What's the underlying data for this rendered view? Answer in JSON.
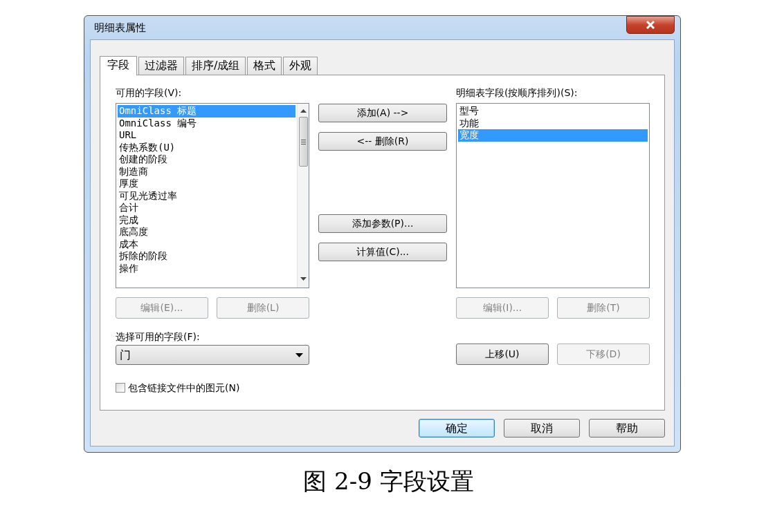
{
  "window": {
    "title": "明细表属性"
  },
  "tabs": [
    {
      "label": "字段",
      "selected": true
    },
    {
      "label": "过滤器",
      "selected": false
    },
    {
      "label": "排序/成组",
      "selected": false
    },
    {
      "label": "格式",
      "selected": false
    },
    {
      "label": "外观",
      "selected": false
    }
  ],
  "available_fields": {
    "label": "可用的字段(V):",
    "items": [
      {
        "text": "OmniClass 标题",
        "selected": true
      },
      {
        "text": "OmniClass 编号",
        "selected": false
      },
      {
        "text": "URL",
        "selected": false
      },
      {
        "text": "传热系数(U)",
        "selected": false
      },
      {
        "text": "创建的阶段",
        "selected": false
      },
      {
        "text": "制造商",
        "selected": false
      },
      {
        "text": "厚度",
        "selected": false
      },
      {
        "text": "可见光透过率",
        "selected": false
      },
      {
        "text": "合计",
        "selected": false
      },
      {
        "text": "完成",
        "selected": false
      },
      {
        "text": "底高度",
        "selected": false
      },
      {
        "text": "成本",
        "selected": false
      },
      {
        "text": "拆除的阶段",
        "selected": false
      },
      {
        "text": "操作",
        "selected": false
      }
    ],
    "buttons": [
      {
        "label": "编辑(E)...",
        "disabled": true
      },
      {
        "label": "删除(L)",
        "disabled": true
      }
    ]
  },
  "middle_buttons": [
    {
      "label": "添加(A) -->",
      "disabled": false
    },
    {
      "label": "<-- 删除(R)",
      "disabled": false
    },
    {
      "label": "添加参数(P)...",
      "disabled": false
    },
    {
      "label": "计算值(C)...",
      "disabled": false
    }
  ],
  "schedule_fields": {
    "label": "明细表字段(按顺序排列)(S):",
    "items": [
      {
        "text": "型号",
        "selected": false
      },
      {
        "text": "功能",
        "selected": false
      },
      {
        "text": "宽度",
        "selected": true
      }
    ],
    "buttons": [
      {
        "label": "编辑(I)...",
        "disabled": true
      },
      {
        "label": "删除(T)",
        "disabled": true
      }
    ],
    "move_buttons": [
      {
        "label": "上移(U)",
        "disabled": false
      },
      {
        "label": "下移(D)",
        "disabled": true
      }
    ]
  },
  "select_fields": {
    "label": "选择可用的字段(F):",
    "value": "门"
  },
  "include_linked": {
    "label": "包含链接文件中的图元(N)",
    "checked": false
  },
  "footer_buttons": [
    {
      "label": "确定",
      "default": true
    },
    {
      "label": "取消",
      "default": false
    },
    {
      "label": "帮助",
      "default": false
    }
  ],
  "caption": "图 2-9 字段设置"
}
